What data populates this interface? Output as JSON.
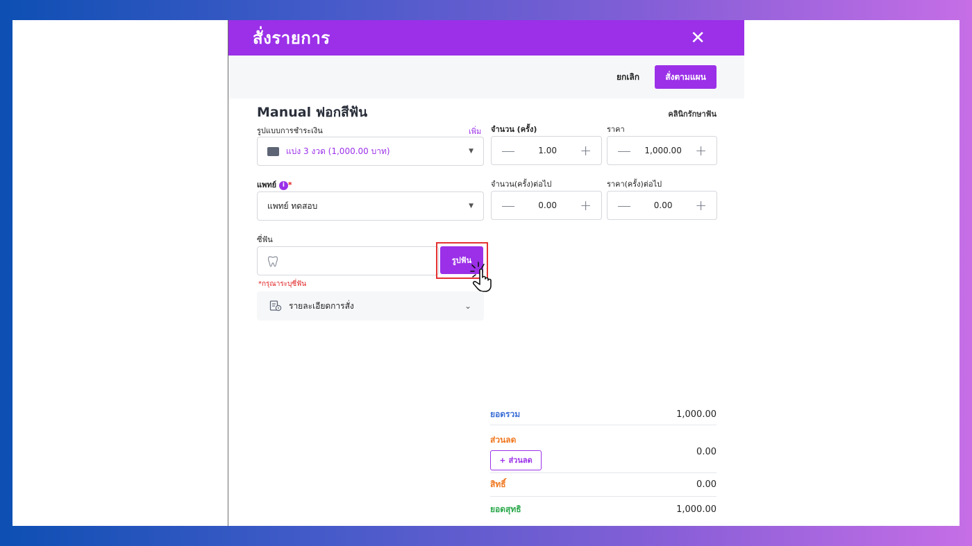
{
  "modal": {
    "title": "สั่งรายการ",
    "close_icon": "close-icon"
  },
  "toolbar": {
    "cancel_label": "ยกเลิก",
    "order_by_plan_label": "สั่งตามแผน"
  },
  "item": {
    "title": "Manual ฟอกสีฟัน",
    "clinic": "คลินิกรักษาฟัน"
  },
  "payment": {
    "label": "รูปแบบการชำระเงิน",
    "add_label": "เพิ่ม",
    "value": "แบ่ง 3 งวด (1,000.00 บาท)",
    "icon": "wallet-icon"
  },
  "quantity": {
    "label": "จำนวน (ครั้ง)",
    "value": "1.00",
    "minus": "—",
    "plus": "+"
  },
  "price": {
    "label": "ราคา",
    "value": "1,000.00",
    "minus": "—",
    "plus": "+"
  },
  "doctor": {
    "label": "แพทย์",
    "required_mark": "*",
    "info_glyph": "i",
    "value": "แพทย์ ทดสอบ"
  },
  "next_quantity": {
    "label": "จำนวน(ครั้ง)ต่อไป",
    "value": "0.00",
    "minus": "—",
    "plus": "+"
  },
  "next_price": {
    "label": "ราคา(ครั้ง)ต่อไป",
    "value": "0.00",
    "minus": "—",
    "plus": "+"
  },
  "tooth": {
    "label": "ซี่ฟัน",
    "button_label": "รูปฟัน",
    "error_text": "*กรุณาระบุซี่ฟัน",
    "icon": "tooth-icon"
  },
  "order_details": {
    "label": "รายละเอียดการสั่ง"
  },
  "summary": {
    "total_label": "ยอดรวม",
    "total_value": "1,000.00",
    "discount_label": "ส่วนลด",
    "discount_button": "ส่วนลด",
    "discount_value": "0.00",
    "privilege_label": "สิทธิ์",
    "privilege_value": "0.00",
    "net_label": "ยอดสุทธิ",
    "net_value": "1,000.00"
  },
  "colors": {
    "accent": "#9b30e8",
    "total": "#3d6fd6",
    "discount": "#f07820",
    "net": "#2aa84a",
    "highlight_frame": "#e53030"
  }
}
